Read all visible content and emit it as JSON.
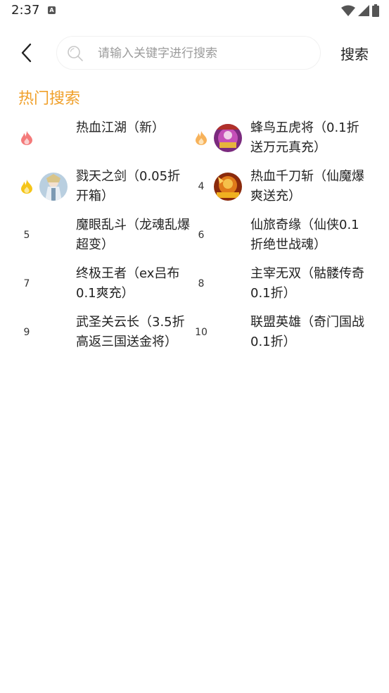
{
  "status_bar": {
    "time": "2:37",
    "notification_glyph": "A",
    "icons": [
      "wifi-icon",
      "signal-icon",
      "battery-icon"
    ]
  },
  "header": {
    "back_icon": "chevron-left-icon",
    "search_icon": "search-icon",
    "search_placeholder": "请输入关键字进行搜索",
    "search_value": "",
    "search_button_label": "搜索"
  },
  "hot_section": {
    "title": "热门搜索",
    "accent_color": "#f0a02a",
    "items": [
      {
        "rank": "1",
        "rank_icon": "flame-red-icon",
        "name": "热血江湖（新）",
        "has_game_icon": false
      },
      {
        "rank": "2",
        "rank_icon": "flame-orange-icon",
        "name": "蜂鸟五虎将（0.1折送万元真充）",
        "has_game_icon": true
      },
      {
        "rank": "3",
        "rank_icon": "flame-yellow-icon",
        "name": "戮天之剑（0.05折开箱）",
        "has_game_icon": true
      },
      {
        "rank": "4",
        "rank_icon": "",
        "name": "热血千刀斩（仙魔爆爽送充）",
        "has_game_icon": true
      },
      {
        "rank": "5",
        "rank_icon": "",
        "name": "魔眼乱斗（龙魂乱爆超变）",
        "has_game_icon": false
      },
      {
        "rank": "6",
        "rank_icon": "",
        "name": "仙旅奇缘（仙侠0.1折绝世战魂）",
        "has_game_icon": false
      },
      {
        "rank": "7",
        "rank_icon": "",
        "name": "终极王者（ex吕布0.1爽充）",
        "has_game_icon": false
      },
      {
        "rank": "8",
        "rank_icon": "",
        "name": "主宰无双（骷髅传奇0.1折）",
        "has_game_icon": false
      },
      {
        "rank": "9",
        "rank_icon": "",
        "name": "武圣关云长（3.5折高返三国送金将）",
        "has_game_icon": false
      },
      {
        "rank": "10",
        "rank_icon": "",
        "name": "联盟英雄（奇门国战0.1折）",
        "has_game_icon": false
      }
    ]
  }
}
